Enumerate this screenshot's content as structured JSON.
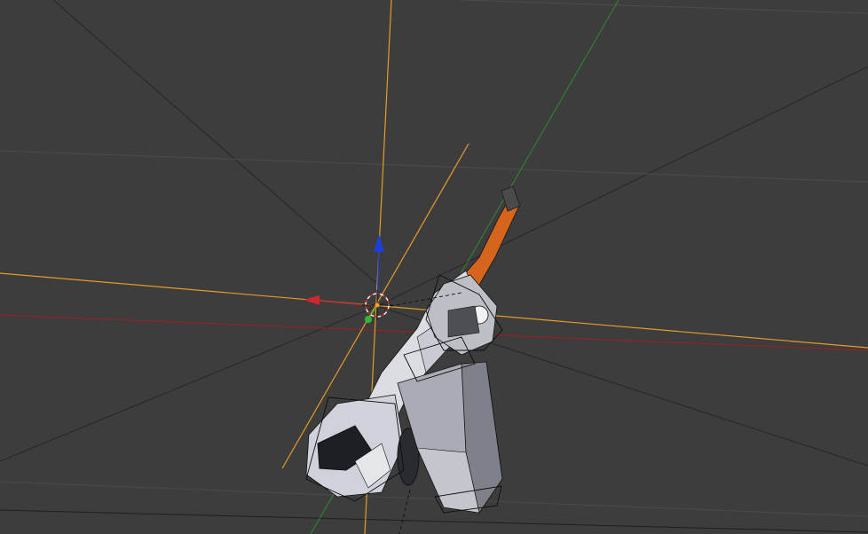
{
  "app": {
    "name": "3D Viewport",
    "view": "perspective",
    "colors": {
      "background": "#3d3d3d",
      "grid_line": "#2a2a2a",
      "grid_light": "#555555",
      "x_axis": "#b8282d",
      "y_axis": "#3d9a3a",
      "z_axis": "#1c3fd6",
      "camera_line": "#e69a2a",
      "cursor": "#f2f2f2",
      "selected_orange": "#d5651d",
      "mesh_light": "#cfd2db",
      "mesh_dark": "#1d1f24",
      "wire": "#111111"
    },
    "elements": {
      "gizmo": [
        "move-x-arrow",
        "move-y-handle",
        "move-z-arrow"
      ],
      "cursor_icon": "3d-cursor-icon",
      "object": "character-model-mesh"
    }
  }
}
